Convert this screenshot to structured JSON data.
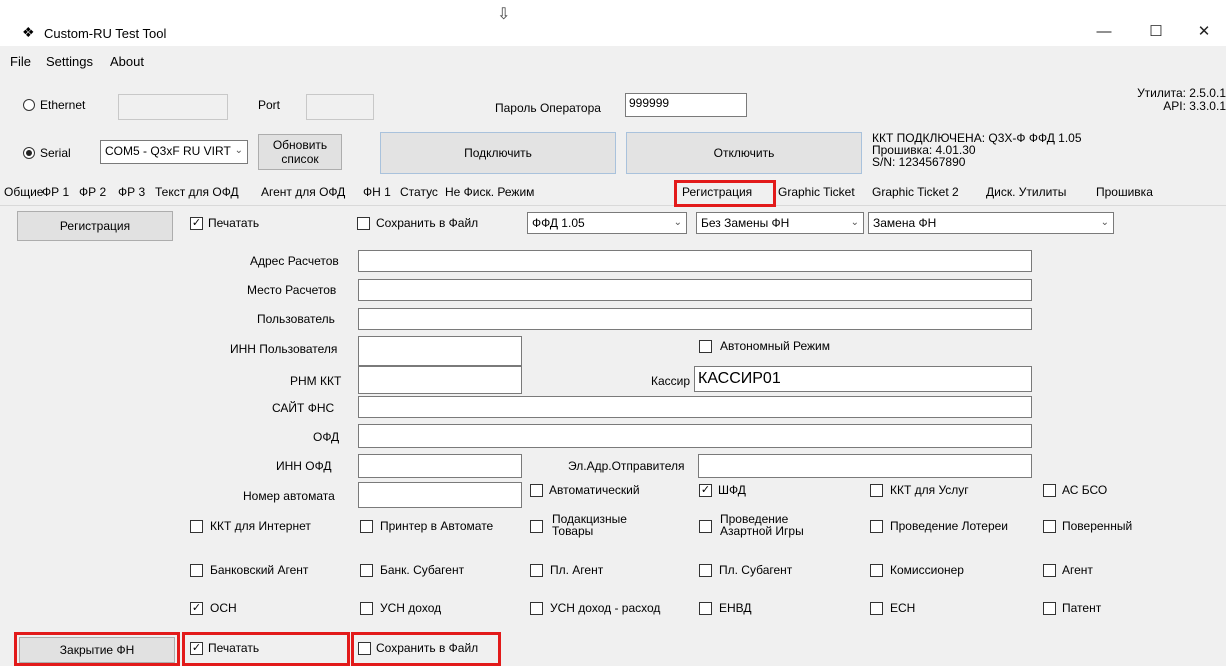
{
  "window": {
    "title": "Custom-RU Test Tool",
    "min": "—",
    "max": "☐",
    "close": "✕"
  },
  "menu": [
    "File",
    "Settings",
    "About"
  ],
  "connection": {
    "ethernet_label": "Ethernet",
    "port_label": "Port",
    "serial_label": "Serial",
    "serial_value": "COM5 - Q3xF RU VIRT",
    "refresh_label_1": "Обновить",
    "refresh_label_2": "список",
    "operator_password_label": "Пароль Оператора",
    "operator_password_value": "999999",
    "connect_label": "Подключить",
    "disconnect_label": "Отключить",
    "status_line1": "ККТ ПОДКЛЮЧЕНА: Q3X-Ф  ФФД 1.05",
    "status_line2": "Прошивка: 4.01.30",
    "status_line3": "S/N: 1234567890",
    "util_version": "Утилита: 2.5.0.1",
    "api_version": "API: 3.3.0.1"
  },
  "tabs": [
    "Общие",
    "ФР 1",
    "ФР 2",
    "ФР 3",
    "Текст для ОФД",
    "Агент для ОФД",
    "ФН 1",
    "Статус",
    "Не Фиск. Режим",
    "Регистрация",
    "Graphic Ticket",
    "Graphic Ticket 2",
    "Диск. Утилиты",
    "Прошивка"
  ],
  "active_tab": "Регистрация",
  "registration": {
    "button": "Регистрация",
    "print_label": "Печатать",
    "save_label": "Сохранить в Файл",
    "ffd_value": "ФФД 1.05",
    "replace_mode_value": "Без Замены ФН",
    "replace_fn_value": "Замена ФН"
  },
  "fields": {
    "address_label": "Адрес Расчетов",
    "place_label": "Место Расчетов",
    "user_label": "Пользователь",
    "user_inn_label": "ИНН Пользователя",
    "autonomous_label": "Автономный Режим",
    "rnm_label": "РНМ ККТ",
    "cashier_label": "Кассир",
    "cashier_value": "КАССИР01",
    "fns_site_label": "САЙТ ФНС",
    "ofd_label": "ОФД",
    "ofd_inn_label": "ИНН ОФД",
    "sender_email_label": "Эл.Адр.Отправителя",
    "machine_number_label": "Номер автомата"
  },
  "options_row1": [
    "Автоматический",
    "ШФД",
    "ККТ для Услуг",
    "АС БСО"
  ],
  "options_row2": [
    "ККТ для Интернет",
    "Принтер в Автомате",
    "Подакцизные",
    "Товары",
    "Проведение",
    "Азартной Игры",
    "Проведение Лотереи",
    "Поверенный"
  ],
  "options_row3": [
    "Банковский Агент",
    "Банк. Субагент",
    "Пл. Агент",
    "Пл. Субагент",
    "Комиссионер",
    "Агент"
  ],
  "tax_row": [
    "ОСН",
    "УСН доход",
    "УСН доход - расход",
    "ЕНВД",
    "ЕСН",
    "Патент"
  ],
  "close_fn": {
    "button": "Закрытие ФН",
    "print_label": "Печатать",
    "save_label": "Сохранить в Файл"
  },
  "colors": {
    "highlight": "#e21a1a"
  }
}
